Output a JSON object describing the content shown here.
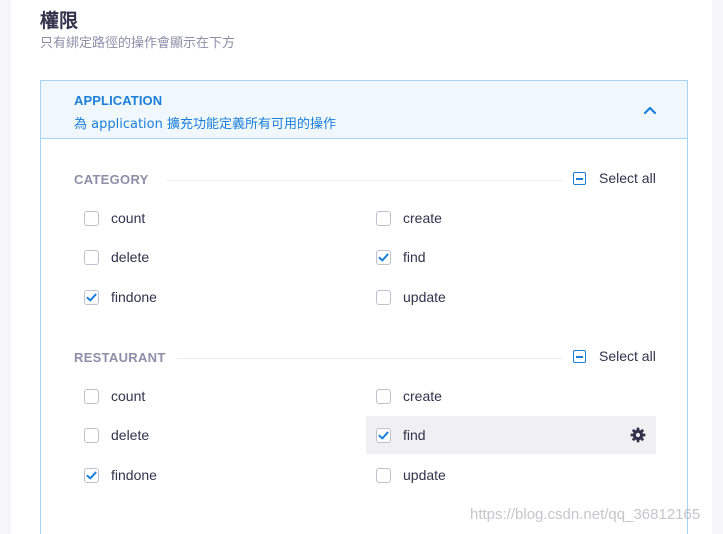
{
  "header": {
    "title": "權限",
    "subtitle": "只有綁定路徑的操作會顯示在下方"
  },
  "application": {
    "name": "APPLICATION",
    "description": "為 application 擴充功能定義所有可用的操作"
  },
  "sections": [
    {
      "title": "CATEGORY",
      "select_all": "Select all",
      "permissions": [
        {
          "label": "count",
          "checked": false
        },
        {
          "label": "create",
          "checked": false
        },
        {
          "label": "delete",
          "checked": false
        },
        {
          "label": "find",
          "checked": true
        },
        {
          "label": "findone",
          "checked": true
        },
        {
          "label": "update",
          "checked": false
        }
      ]
    },
    {
      "title": "RESTAURANT",
      "select_all": "Select all",
      "permissions": [
        {
          "label": "count",
          "checked": false
        },
        {
          "label": "create",
          "checked": false
        },
        {
          "label": "delete",
          "checked": false
        },
        {
          "label": "find",
          "checked": true,
          "highlighted": true,
          "settings_icon": "gear-icon"
        },
        {
          "label": "findone",
          "checked": true
        },
        {
          "label": "update",
          "checked": false
        }
      ]
    }
  ],
  "watermark": "https://blog.csdn.net/qq_36812165",
  "colors": {
    "accent": "#1a7fd8",
    "header_bg": "#f0f7fd",
    "border": "#a7d4f0",
    "muted": "#8e8ea9",
    "text": "#32324d"
  }
}
